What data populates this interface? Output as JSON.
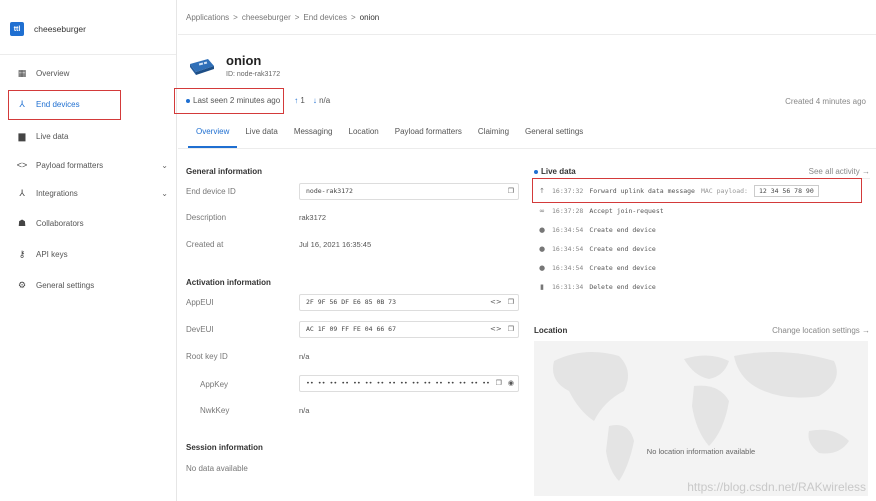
{
  "app": {
    "logo_text": "ttl",
    "name": "cheeseburger"
  },
  "sidebar": {
    "items": [
      {
        "label": "Overview",
        "icon": "grid-icon"
      },
      {
        "label": "End devices",
        "icon": "network-icon"
      },
      {
        "label": "Live data",
        "icon": "chart-icon"
      },
      {
        "label": "Payload formatters",
        "icon": "code-icon"
      },
      {
        "label": "Integrations",
        "icon": "fork-icon"
      },
      {
        "label": "Collaborators",
        "icon": "users-icon"
      },
      {
        "label": "API keys",
        "icon": "key-icon"
      },
      {
        "label": "General settings",
        "icon": "gear-icon"
      }
    ]
  },
  "breadcrumb": {
    "items": [
      "Applications",
      "cheeseburger",
      "End devices",
      "onion"
    ],
    "separator": ">"
  },
  "device": {
    "name": "onion",
    "id_label": "ID: node-rak3172"
  },
  "status": {
    "last_seen": "Last seen 2 minutes ago",
    "uplink": "1",
    "downlink": "n/a",
    "created": "Created 4 minutes ago"
  },
  "tabs": [
    "Overview",
    "Live data",
    "Messaging",
    "Location",
    "Payload formatters",
    "Claiming",
    "General settings"
  ],
  "general": {
    "title": "General information",
    "end_device_id_label": "End device ID",
    "end_device_id": "node-rak3172",
    "description_label": "Description",
    "description": "rak3172",
    "created_label": "Created at",
    "created": "Jul 16, 2021 16:35:45"
  },
  "activation": {
    "title": "Activation information",
    "appeui_label": "AppEUI",
    "appeui": "2F 9F 56 DF E6 85 0B 73",
    "deveui_label": "DevEUI",
    "deveui": "AC 1F 09 FF FE 04 66 67",
    "root_key_label": "Root key ID",
    "root_key": "n/a",
    "appkey_label": "AppKey",
    "appkey": "•• •• •• •• •• •• •• •• •• •• •• •• •• •• •• ••",
    "nwkkey_label": "NwkKey",
    "nwkkey": "n/a"
  },
  "session": {
    "title": "Session information",
    "value": "No data available"
  },
  "live": {
    "title": "Live data",
    "see_all": "See all activity →",
    "events": [
      {
        "icon": "arrow-up-icon",
        "glyph": "↑",
        "time": "16:37:32",
        "text": "Forward uplink data message",
        "meta": "MAC payload:",
        "payload": "12 34 56 78 90"
      },
      {
        "icon": "link-icon",
        "glyph": "∞",
        "time": "16:37:28",
        "text": "Accept join-request",
        "meta": "",
        "payload": ""
      },
      {
        "icon": "plus-circle-icon",
        "glyph": "●",
        "time": "16:34:54",
        "text": "Create end device",
        "meta": "",
        "payload": ""
      },
      {
        "icon": "plus-circle-icon",
        "glyph": "●",
        "time": "16:34:54",
        "text": "Create end device",
        "meta": "",
        "payload": ""
      },
      {
        "icon": "plus-circle-icon",
        "glyph": "●",
        "time": "16:34:54",
        "text": "Create end device",
        "meta": "",
        "payload": ""
      },
      {
        "icon": "trash-icon",
        "glyph": "▮",
        "time": "16:31:34",
        "text": "Delete end device",
        "meta": "",
        "payload": ""
      }
    ]
  },
  "location": {
    "title": "Location",
    "change": "Change location settings →",
    "empty": "No location information available"
  },
  "watermark": "https://blog.csdn.net/RAKwireless",
  "colors": {
    "accent": "#1f6fd1",
    "highlight": "#d33a3a"
  }
}
